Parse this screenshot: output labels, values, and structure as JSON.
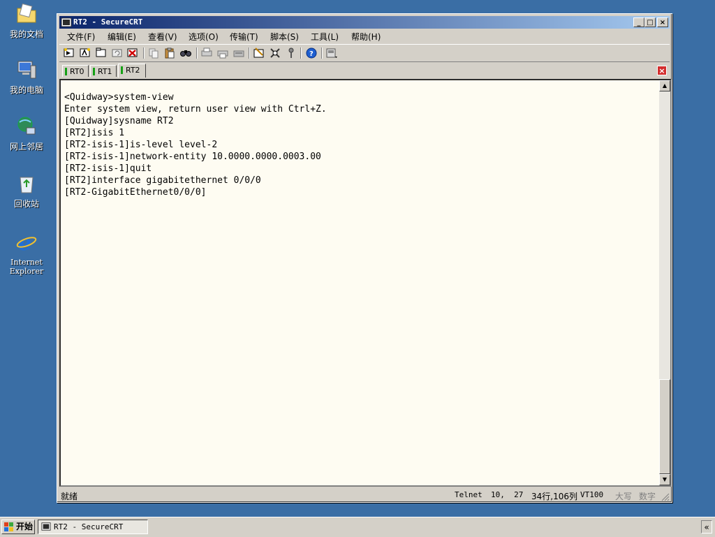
{
  "desktop": {
    "icons": [
      {
        "label": "我的文档",
        "icon": "my-documents-icon"
      },
      {
        "label": "我的电脑",
        "icon": "my-computer-icon"
      },
      {
        "label": "网上邻居",
        "icon": "network-places-icon"
      },
      {
        "label": "回收站",
        "icon": "recycle-bin-icon"
      },
      {
        "label": "Internet Explorer",
        "icon": "internet-explorer-icon"
      }
    ]
  },
  "window": {
    "title": "RT2 - SecureCRT",
    "minimize": "_",
    "maximize": "□",
    "close": "×"
  },
  "menu": [
    {
      "label": "文件(F)"
    },
    {
      "label": "编辑(E)"
    },
    {
      "label": "查看(V)"
    },
    {
      "label": "选项(O)"
    },
    {
      "label": "传输(T)"
    },
    {
      "label": "脚本(S)"
    },
    {
      "label": "工具(L)"
    },
    {
      "label": "帮助(H)"
    }
  ],
  "toolbar": {
    "icons": [
      "connect-icon",
      "quick-connect-icon",
      "connect-tab-icon",
      "reconnect-icon",
      "disconnect-icon",
      "copy-icon",
      "paste-icon",
      "find-icon",
      "print-icon",
      "print-selection-icon",
      "print-setup-icon",
      "session-options-icon",
      "global-options-icon",
      "keymap-icon",
      "help-icon",
      "sftp-icon"
    ]
  },
  "tabs": [
    {
      "label": "RT0",
      "active": false
    },
    {
      "label": "RT1",
      "active": false
    },
    {
      "label": "RT2",
      "active": true
    }
  ],
  "tab_close": "×",
  "terminal": {
    "lines": [
      "<Quidway>system-view",
      "Enter system view, return user view with Ctrl+Z.",
      "[Quidway]sysname RT2",
      "[RT2]isis 1",
      "[RT2-isis-1]is-level level-2",
      "[RT2-isis-1]network-entity 10.0000.0000.0003.00",
      "[RT2-isis-1]quit",
      "[RT2]interface gigabitethernet 0/0/0",
      "[RT2-GigabitEthernet0/0/0]"
    ],
    "background": "#fefcf2"
  },
  "status": {
    "ready": "就绪",
    "protocol": "Telnet",
    "cursor": "10,  27",
    "size": "34行,106列",
    "emulation": "VT100",
    "caps": "大写",
    "num": "数字"
  },
  "taskbar": {
    "start_label": "开始",
    "task_label": "RT2 - SecureCRT",
    "tray_arrow": "«"
  },
  "colors": {
    "desktop": "#3a6ea5",
    "titlebar_start": "#0a246a",
    "titlebar_end": "#a6caf0",
    "tab_indicator": "#16a016",
    "tab_close": "#d32f2f"
  }
}
